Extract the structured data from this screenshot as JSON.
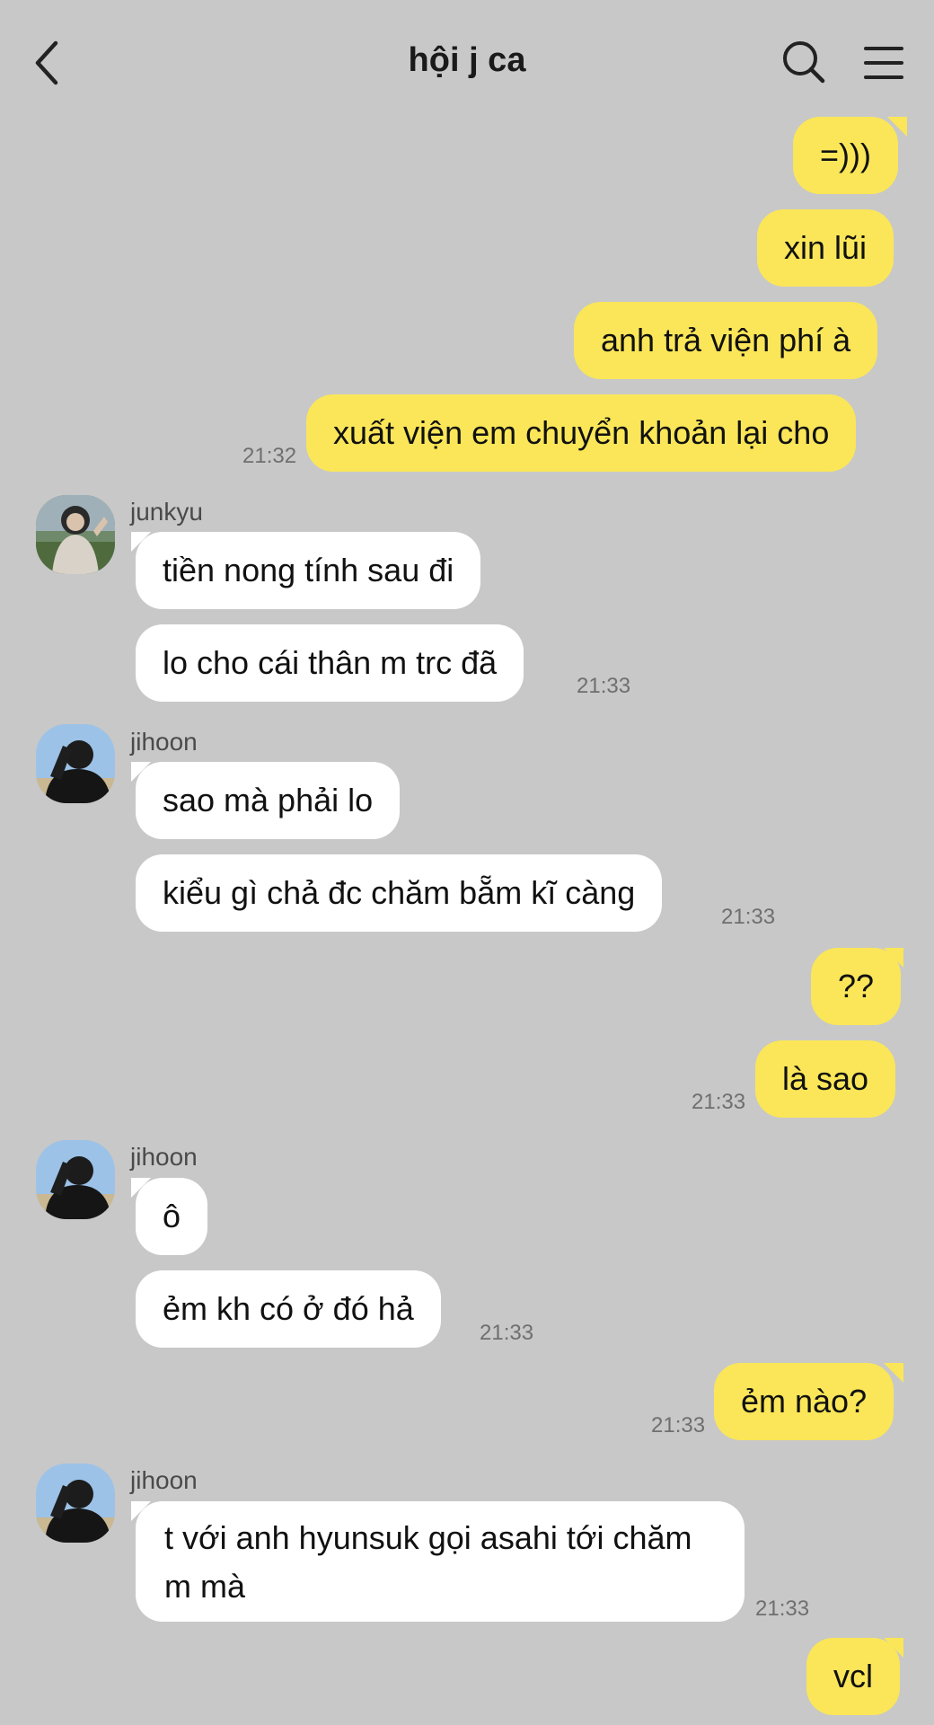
{
  "header": {
    "title": "hội j ca"
  },
  "messages": [
    {
      "text": "=)))"
    },
    {
      "text": "xin lũi"
    },
    {
      "text": "anh trả viện phí à"
    },
    {
      "text": "xuất viện em chuyển khoản lại cho",
      "time": "21:32"
    },
    {
      "sender": "junkyu",
      "text": "tiền nong tính sau đi"
    },
    {
      "text": "lo cho cái thân m trc đã",
      "time": "21:33"
    },
    {
      "sender": "jihoon",
      "text": "sao mà phải lo"
    },
    {
      "text": "kiểu gì chả đc chăm bẵm kĩ càng",
      "time": "21:33"
    },
    {
      "text": "??"
    },
    {
      "text": "là sao",
      "time": "21:33"
    },
    {
      "sender": "jihoon",
      "text": "ô"
    },
    {
      "text": "ẻm kh có ở đó hả",
      "time": "21:33"
    },
    {
      "text": "ẻm nào?",
      "time": "21:33"
    },
    {
      "sender": "jihoon",
      "text": "t với anh hyunsuk gọi asahi tới chăm m mà",
      "time": "21:33"
    },
    {
      "text": "vcl"
    }
  ]
}
